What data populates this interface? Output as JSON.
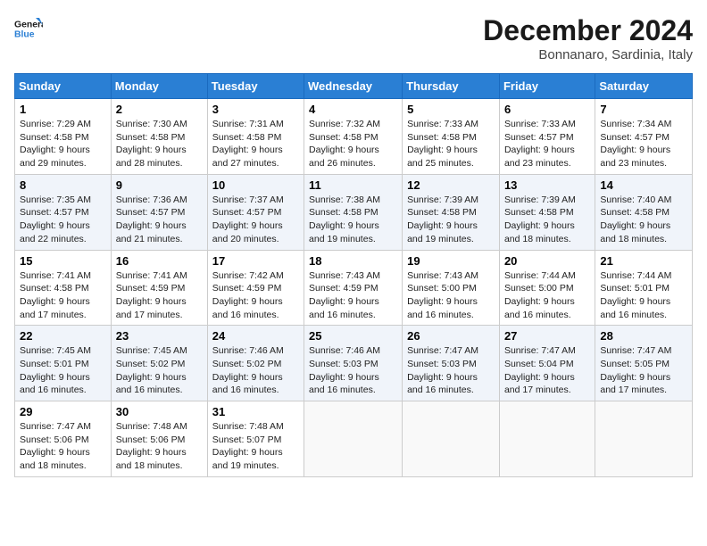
{
  "logo": {
    "line1": "General",
    "line2": "Blue"
  },
  "title": "December 2024",
  "subtitle": "Bonnanaro, Sardinia, Italy",
  "days_header": [
    "Sunday",
    "Monday",
    "Tuesday",
    "Wednesday",
    "Thursday",
    "Friday",
    "Saturday"
  ],
  "weeks": [
    [
      {
        "day": "1",
        "sunrise": "7:29 AM",
        "sunset": "4:58 PM",
        "daylight": "9 hours and 29 minutes."
      },
      {
        "day": "2",
        "sunrise": "7:30 AM",
        "sunset": "4:58 PM",
        "daylight": "9 hours and 28 minutes."
      },
      {
        "day": "3",
        "sunrise": "7:31 AM",
        "sunset": "4:58 PM",
        "daylight": "9 hours and 27 minutes."
      },
      {
        "day": "4",
        "sunrise": "7:32 AM",
        "sunset": "4:58 PM",
        "daylight": "9 hours and 26 minutes."
      },
      {
        "day": "5",
        "sunrise": "7:33 AM",
        "sunset": "4:58 PM",
        "daylight": "9 hours and 25 minutes."
      },
      {
        "day": "6",
        "sunrise": "7:33 AM",
        "sunset": "4:57 PM",
        "daylight": "9 hours and 23 minutes."
      },
      {
        "day": "7",
        "sunrise": "7:34 AM",
        "sunset": "4:57 PM",
        "daylight": "9 hours and 23 minutes."
      }
    ],
    [
      {
        "day": "8",
        "sunrise": "7:35 AM",
        "sunset": "4:57 PM",
        "daylight": "9 hours and 22 minutes."
      },
      {
        "day": "9",
        "sunrise": "7:36 AM",
        "sunset": "4:57 PM",
        "daylight": "9 hours and 21 minutes."
      },
      {
        "day": "10",
        "sunrise": "7:37 AM",
        "sunset": "4:57 PM",
        "daylight": "9 hours and 20 minutes."
      },
      {
        "day": "11",
        "sunrise": "7:38 AM",
        "sunset": "4:58 PM",
        "daylight": "9 hours and 19 minutes."
      },
      {
        "day": "12",
        "sunrise": "7:39 AM",
        "sunset": "4:58 PM",
        "daylight": "9 hours and 19 minutes."
      },
      {
        "day": "13",
        "sunrise": "7:39 AM",
        "sunset": "4:58 PM",
        "daylight": "9 hours and 18 minutes."
      },
      {
        "day": "14",
        "sunrise": "7:40 AM",
        "sunset": "4:58 PM",
        "daylight": "9 hours and 18 minutes."
      }
    ],
    [
      {
        "day": "15",
        "sunrise": "7:41 AM",
        "sunset": "4:58 PM",
        "daylight": "9 hours and 17 minutes."
      },
      {
        "day": "16",
        "sunrise": "7:41 AM",
        "sunset": "4:59 PM",
        "daylight": "9 hours and 17 minutes."
      },
      {
        "day": "17",
        "sunrise": "7:42 AM",
        "sunset": "4:59 PM",
        "daylight": "9 hours and 16 minutes."
      },
      {
        "day": "18",
        "sunrise": "7:43 AM",
        "sunset": "4:59 PM",
        "daylight": "9 hours and 16 minutes."
      },
      {
        "day": "19",
        "sunrise": "7:43 AM",
        "sunset": "5:00 PM",
        "daylight": "9 hours and 16 minutes."
      },
      {
        "day": "20",
        "sunrise": "7:44 AM",
        "sunset": "5:00 PM",
        "daylight": "9 hours and 16 minutes."
      },
      {
        "day": "21",
        "sunrise": "7:44 AM",
        "sunset": "5:01 PM",
        "daylight": "9 hours and 16 minutes."
      }
    ],
    [
      {
        "day": "22",
        "sunrise": "7:45 AM",
        "sunset": "5:01 PM",
        "daylight": "9 hours and 16 minutes."
      },
      {
        "day": "23",
        "sunrise": "7:45 AM",
        "sunset": "5:02 PM",
        "daylight": "9 hours and 16 minutes."
      },
      {
        "day": "24",
        "sunrise": "7:46 AM",
        "sunset": "5:02 PM",
        "daylight": "9 hours and 16 minutes."
      },
      {
        "day": "25",
        "sunrise": "7:46 AM",
        "sunset": "5:03 PM",
        "daylight": "9 hours and 16 minutes."
      },
      {
        "day": "26",
        "sunrise": "7:47 AM",
        "sunset": "5:03 PM",
        "daylight": "9 hours and 16 minutes."
      },
      {
        "day": "27",
        "sunrise": "7:47 AM",
        "sunset": "5:04 PM",
        "daylight": "9 hours and 17 minutes."
      },
      {
        "day": "28",
        "sunrise": "7:47 AM",
        "sunset": "5:05 PM",
        "daylight": "9 hours and 17 minutes."
      }
    ],
    [
      {
        "day": "29",
        "sunrise": "7:47 AM",
        "sunset": "5:06 PM",
        "daylight": "9 hours and 18 minutes."
      },
      {
        "day": "30",
        "sunrise": "7:48 AM",
        "sunset": "5:06 PM",
        "daylight": "9 hours and 18 minutes."
      },
      {
        "day": "31",
        "sunrise": "7:48 AM",
        "sunset": "5:07 PM",
        "daylight": "9 hours and 19 minutes."
      },
      null,
      null,
      null,
      null
    ]
  ]
}
